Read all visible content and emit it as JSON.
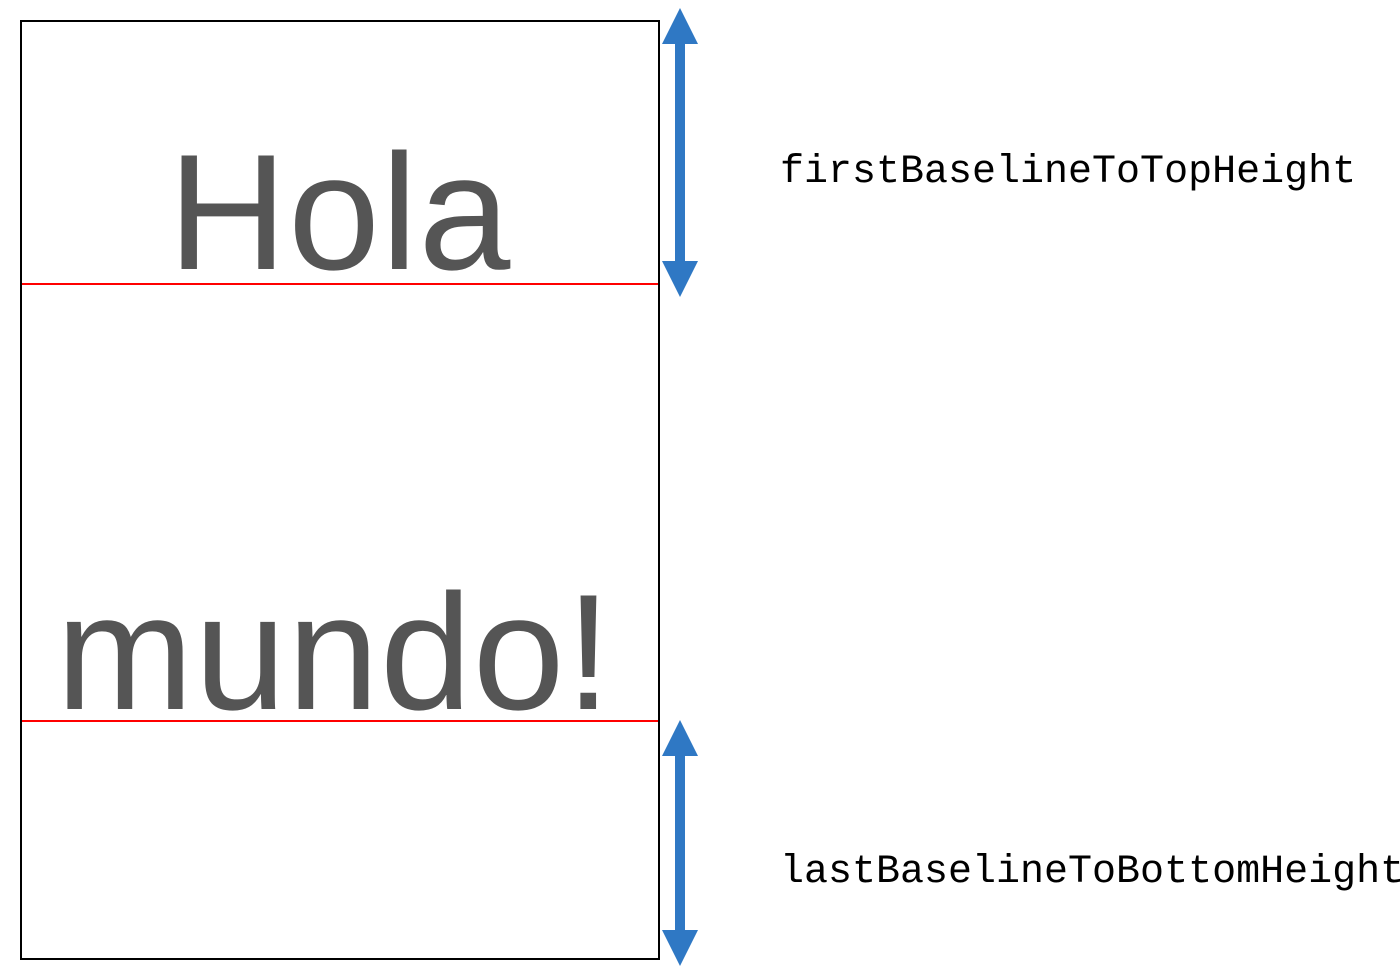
{
  "diagram": {
    "text_line_1": "Hola",
    "text_line_2": "mundo!",
    "label_top": "firstBaselineToTopHeight",
    "label_bottom": "lastBaselineToBottomHeight",
    "colors": {
      "arrow": "#2f78c4",
      "baseline": "#ff0000",
      "text": "#555555"
    }
  }
}
